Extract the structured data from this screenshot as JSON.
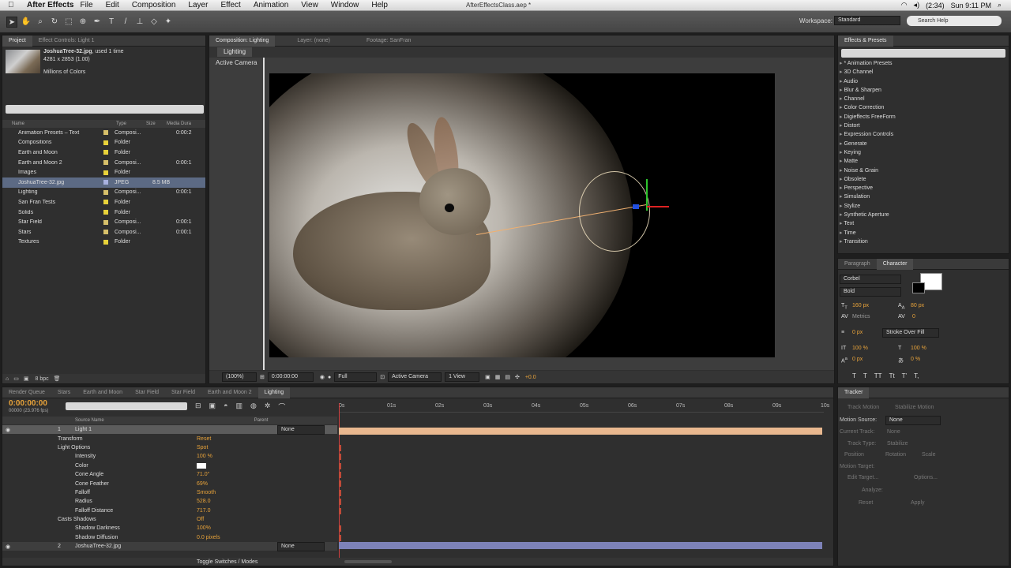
{
  "menubar": {
    "app": "After Effects",
    "items": [
      "File",
      "Edit",
      "Composition",
      "Layer",
      "Effect",
      "Animation",
      "View",
      "Window",
      "Help"
    ],
    "document": "AfterEffectsClass.aep *",
    "battery": "(2:34)",
    "clock": "Sun 9:11 PM"
  },
  "toolbar": {
    "workspace_label": "Workspace:",
    "workspace_value": "Standard",
    "search_help": "Search Help"
  },
  "project": {
    "tabs": [
      "Project",
      "Effect Controls: Light 1"
    ],
    "file_name": "JoshuaTree-32.jpg",
    "file_used": ", used 1 time",
    "file_dims": "4281 x 2853 (1.00)",
    "file_colors": "Millions of Colors",
    "columns": {
      "name": "Name",
      "type": "Type",
      "size": "Size",
      "media": "Media Dura"
    },
    "items": [
      {
        "name": "Animation Presets – Text",
        "type": "Composi...",
        "size": "",
        "media": "0:00:2",
        "color": "#d7c06a"
      },
      {
        "name": "Compositions",
        "type": "Folder",
        "size": "",
        "media": "",
        "color": "#e8d23a"
      },
      {
        "name": "Earth and Moon",
        "type": "Folder",
        "size": "",
        "media": "",
        "color": "#e8d23a"
      },
      {
        "name": "Earth and Moon 2",
        "type": "Composi...",
        "size": "",
        "media": "0:00:1",
        "color": "#d7c06a"
      },
      {
        "name": "Images",
        "type": "Folder",
        "size": "",
        "media": "",
        "color": "#e8d23a"
      },
      {
        "name": "JoshuaTree-32.jpg",
        "type": "JPEG",
        "size": "8.5 MB",
        "media": "",
        "color": "#a8b2e0",
        "selected": true
      },
      {
        "name": "Lighting",
        "type": "Composi...",
        "size": "",
        "media": "0:00:1",
        "color": "#d7c06a"
      },
      {
        "name": "San Fran Tests",
        "type": "Folder",
        "size": "",
        "media": "",
        "color": "#e8d23a"
      },
      {
        "name": "Solids",
        "type": "Folder",
        "size": "",
        "media": "",
        "color": "#e8d23a"
      },
      {
        "name": "Star Field",
        "type": "Composi...",
        "size": "",
        "media": "0:00:1",
        "color": "#d7c06a"
      },
      {
        "name": "Stars",
        "type": "Composi...",
        "size": "",
        "media": "0:00:1",
        "color": "#d7c06a"
      },
      {
        "name": "Textures",
        "type": "Folder",
        "size": "",
        "media": "",
        "color": "#e8d23a"
      }
    ],
    "footer_bpc": "8 bpc"
  },
  "comp": {
    "tabs": [
      "Composition: Lighting",
      "Layer: (none)",
      "Footage: SanFran"
    ],
    "subtab": "Lighting",
    "active_camera": "Active Camera",
    "zoom": "(100%)",
    "timecode": "0:00:00:00",
    "resolution": "Full",
    "camera": "Active Camera",
    "views": "1 View",
    "exposure": "+0.0"
  },
  "effects": {
    "title": "Effects & Presets",
    "items": [
      "* Animation Presets",
      "3D Channel",
      "Audio",
      "Blur & Sharpen",
      "Channel",
      "Color Correction",
      "Digieffects FreeForm",
      "Distort",
      "Expression Controls",
      "Generate",
      "Keying",
      "Matte",
      "Noise & Grain",
      "Obsolete",
      "Perspective",
      "Simulation",
      "Stylize",
      "Synthetic Aperture",
      "Text",
      "Time",
      "Transition"
    ]
  },
  "character": {
    "tabs": [
      "Paragraph",
      "Character"
    ],
    "font": "Corbel",
    "style": "Bold",
    "size": "160 px",
    "leading": "80 px",
    "kerning": "Metrics",
    "tracking": "0",
    "stroke": "0 px",
    "stroke_mode": "Stroke Over Fill",
    "vscale": "100 %",
    "hscale": "100 %",
    "baseline": "0 px",
    "tsume": "0 %"
  },
  "timeline": {
    "tabs": [
      "Render Queue",
      "Stars",
      "Earth and Moon",
      "Star Field",
      "Star Field",
      "Earth and Moon 2",
      "Lighting"
    ],
    "timecode": "0:00:00:00",
    "fps": "00000 (23.976 fps)",
    "ruler": [
      "0s",
      "01s",
      "02s",
      "03s",
      "04s",
      "05s",
      "06s",
      "07s",
      "08s",
      "09s",
      "10s"
    ],
    "col_source": "Source Name",
    "col_parent": "Parent",
    "layers": [
      {
        "label": "1",
        "name": "Light 1",
        "value": "",
        "parent": "None",
        "indent": 0,
        "selected": true
      },
      {
        "label": "",
        "name": "Transform",
        "value": "Reset",
        "indent": 1
      },
      {
        "label": "",
        "name": "Light Options",
        "value": "Spot",
        "indent": 1
      },
      {
        "label": "",
        "name": "Intensity",
        "value": "100 %",
        "indent": 2
      },
      {
        "label": "",
        "name": "Color",
        "value": "",
        "indent": 2
      },
      {
        "label": "",
        "name": "Cone Angle",
        "value": "71.0°",
        "indent": 2
      },
      {
        "label": "",
        "name": "Cone Feather",
        "value": "69%",
        "indent": 2
      },
      {
        "label": "",
        "name": "Falloff",
        "value": "Smooth",
        "indent": 2
      },
      {
        "label": "",
        "name": "Radius",
        "value": "528.0",
        "indent": 2
      },
      {
        "label": "",
        "name": "Falloff Distance",
        "value": "717.0",
        "indent": 2
      },
      {
        "label": "",
        "name": "Casts Shadows",
        "value": "Off",
        "indent": 1
      },
      {
        "label": "",
        "name": "Shadow Darkness",
        "value": "100%",
        "indent": 2
      },
      {
        "label": "",
        "name": "Shadow Diffusion",
        "value": "0.0 pixels",
        "indent": 2
      },
      {
        "label": "2",
        "name": "JoshuaTree-32.jpg",
        "value": "",
        "parent": "None",
        "indent": 0
      }
    ],
    "toggle_label": "Toggle Switches / Modes"
  },
  "tracker": {
    "title": "Tracker",
    "track_motion": "Track Motion",
    "stabilize_motion": "Stabilize Motion",
    "motion_source_label": "Motion Source:",
    "motion_source": "None",
    "current_track_label": "Current Track:",
    "current_track": "None",
    "track_type_label": "Track Type:",
    "track_type": "Stabilize",
    "position": "Position",
    "rotation": "Rotation",
    "scale": "Scale",
    "motion_target": "Motion Target:",
    "edit_target": "Edit Target...",
    "options": "Options...",
    "analyze": "Analyze:",
    "reset": "Reset",
    "apply": "Apply"
  }
}
